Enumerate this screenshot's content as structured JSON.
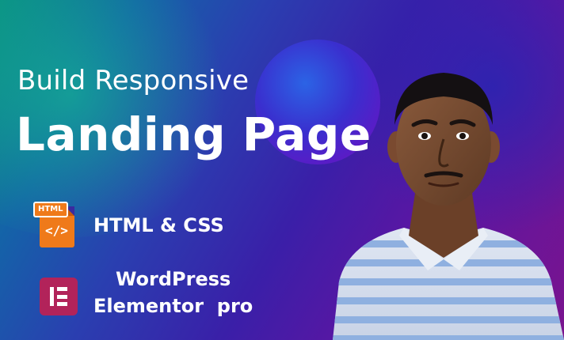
{
  "banner": {
    "headline_small": "Build Responsive",
    "headline_big": "Landing Page"
  },
  "features": [
    {
      "icon": "html-file-icon",
      "icon_tag": "HTML",
      "icon_code": "</>",
      "label": "HTML & CSS"
    },
    {
      "icon": "elementor-icon",
      "label_line1": "WordPress",
      "label_line2": "Elementor  pro"
    }
  ],
  "colors": {
    "html_icon": "#ef7a1a",
    "elementor_icon": "#b2235a",
    "shirt_stripe": "#8fb0e0",
    "text": "#ffffff"
  }
}
